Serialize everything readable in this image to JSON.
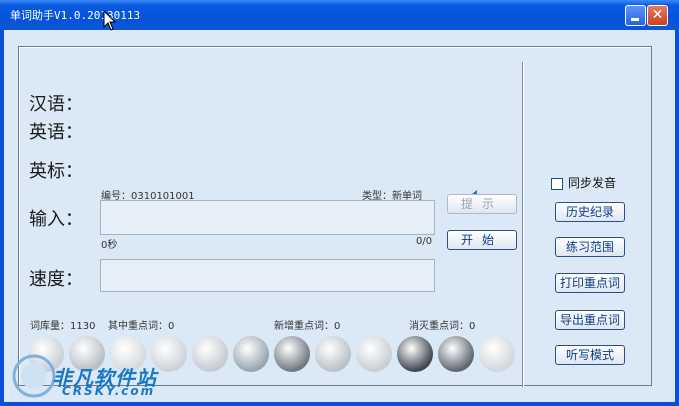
{
  "window": {
    "title": "单词助手V1.0.20130113"
  },
  "labels": {
    "chinese": "汉语：",
    "english": "英语：",
    "phonetic": "英标：",
    "input": "输入：",
    "speed": "速度："
  },
  "word": {
    "number_label": "编号：0310101001",
    "type_label": "类型：新单词",
    "time_label": "0秒",
    "progress_label": "0/0"
  },
  "buttons": {
    "hint": "提示",
    "start": "开始",
    "history": "历史纪录",
    "range": "练习范围",
    "print": "打印重点词",
    "export": "导出重点词",
    "dictation": "听写模式"
  },
  "sync_sound": {
    "label": "同步发音",
    "checked": false
  },
  "stats": {
    "total": "词库量：1130",
    "key": "其中重点词：0",
    "added": "新增重点词：0",
    "removed": "消灭重点词：0"
  },
  "avatars": [
    "face-1",
    "face-2",
    "face-3",
    "face-4",
    "face-5",
    "face-6",
    "face-7",
    "face-8",
    "face-9",
    "face-10",
    "face-11",
    "face-12"
  ],
  "watermark": {
    "brand": "非凡软件站",
    "domain": "CRSKY.com"
  },
  "colors": {
    "titlebar": "#0a5ae2",
    "client_bg": "#dbe8f6",
    "button_text": "#0c3c88",
    "watermark": "#1a78c8"
  }
}
